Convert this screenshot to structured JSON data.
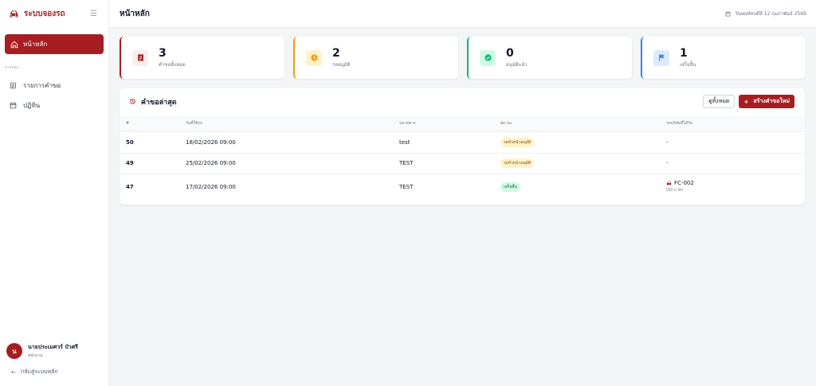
{
  "sidebar": {
    "brand": "ระบบจองรถ",
    "active_item": "หน้าหลัก",
    "section_label": "การจอง",
    "items": [
      {
        "label": "รายการคำขอ"
      },
      {
        "label": "ปฏิทิน"
      }
    ],
    "user": {
      "initial": "น",
      "name": "นายประเมศวร์ บัวศรี",
      "role": "พนักงาน"
    },
    "back_label": "กลับสู่ระบบหลัก"
  },
  "topbar": {
    "title": "หน้าหลัก",
    "date": "วันพฤหัสบดีที่ 12 กุมภาพันธ์ 2569"
  },
  "stats": [
    {
      "value": "3",
      "label": "คำขอทั้งหมด",
      "color": "#a61e22"
    },
    {
      "value": "2",
      "label": "รออนุมัติ",
      "color": "#f59e0b"
    },
    {
      "value": "0",
      "label": "อนุมัติแล้ว",
      "color": "#10b981"
    },
    {
      "value": "1",
      "label": "เสร็จสิ้น",
      "color": "#3b82f6"
    }
  ],
  "recent": {
    "title": "คำขอล่าสุด",
    "view_all": "ดูทั้งหมด",
    "new_request": "สร้างคำขอใหม่",
    "columns": [
      "#",
      "วันที่ใช้รถ",
      "ปลายทาง",
      "สถานะ",
      "รถบริษัทที่ได้รับ"
    ],
    "rows": [
      {
        "id": "50",
        "date": "18/02/2026 09:00",
        "destination": "test",
        "status": "รอหัวหน้าอนุมัติ",
        "car": "-",
        "car_note": ""
      },
      {
        "id": "49",
        "date": "25/02/2026 09:00",
        "destination": "TEST",
        "status": "รอหัวหน้าอนุมัติ",
        "car": "-",
        "car_note": ""
      },
      {
        "id": "47",
        "date": "17/02/2026 09:00",
        "destination": "TEST",
        "status": "เสร็จสิ้น",
        "car": "FC-002",
        "car_note": "(50 บาท)"
      }
    ]
  }
}
